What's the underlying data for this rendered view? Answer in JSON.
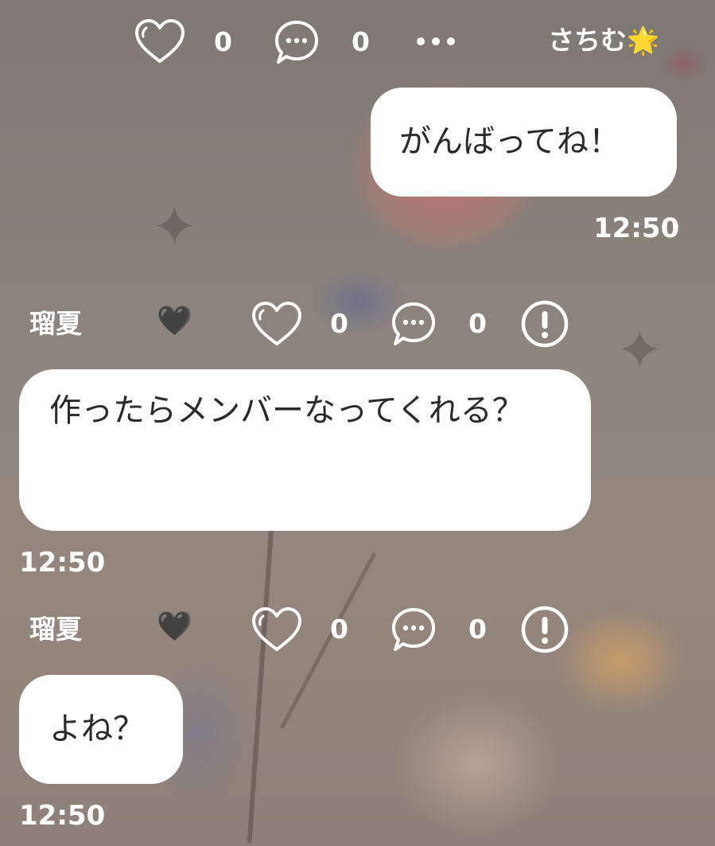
{
  "messages": [
    {
      "sender": "さちむ🌟",
      "likes": "0",
      "comments": "0",
      "text": "がんばってね！",
      "time": "12:50"
    },
    {
      "sender": "瑠夏",
      "sender_badge": "🖤",
      "likes": "0",
      "comments": "0",
      "text": "作ったらメンバーなってくれる？",
      "time": "12:50"
    },
    {
      "sender": "瑠夏",
      "sender_badge": "🖤",
      "likes": "0",
      "comments": "0",
      "text": "よね？",
      "time": "12:50"
    }
  ],
  "icons": {
    "like": "heart-outline-icon",
    "comment": "speech-bubble-ellipsis-icon",
    "more": "more-horizontal-icon",
    "report": "exclamation-circle-icon"
  },
  "colors": {
    "bubble": "#ffffff",
    "bubble_text": "#2a2a2a",
    "meta_text": "#ffffff"
  }
}
